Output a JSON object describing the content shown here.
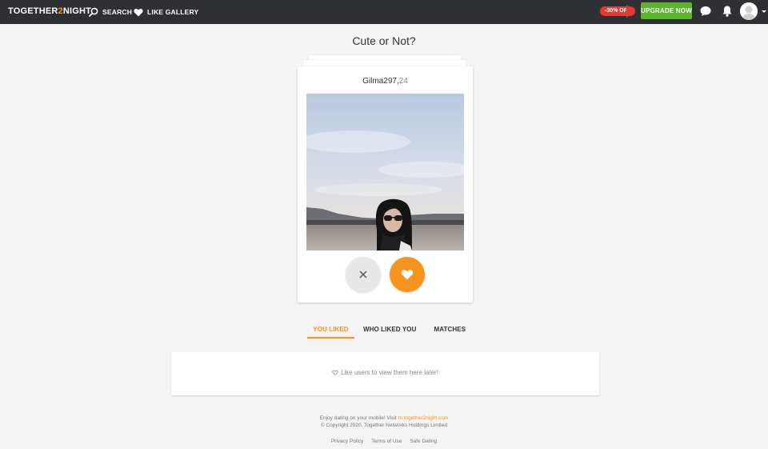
{
  "header": {
    "logo_prefix": "TOGETHER",
    "logo_accent": "2",
    "logo_suffix": "NIGHT",
    "nav": {
      "search_label": "SEARCH",
      "gallery_label": "LIKE GALLERY"
    },
    "offer_badge": "-30% OFF",
    "upgrade_label": "UPGRADE NOW",
    "icons": [
      "search-icon",
      "heart-icon",
      "chat-icon",
      "bell-icon",
      "avatar",
      "caret-down-icon"
    ]
  },
  "page": {
    "title": "Cute or Not?"
  },
  "card": {
    "username": "Gilma297,",
    "age": "24"
  },
  "tabs": {
    "you_liked": "YOU LIKED",
    "who_liked_you": "WHO LIKED YOU",
    "matches": "MATCHES",
    "active": "you_liked"
  },
  "panel": {
    "message": "Like users to view them here later!"
  },
  "footer": {
    "mobile_prefix": "Enjoy dating on your mobile! Visit ",
    "mobile_link": "m.together2night.com",
    "copyright": "© Copyright 2020, Together Networks Holdings Limited",
    "links": {
      "privacy": "Privacy Policy",
      "terms": "Terms of Use",
      "safe": "Safe Dating"
    }
  },
  "colors": {
    "topbar": "#2f3033",
    "accent": "#f7941d",
    "upgrade": "#5bb52f",
    "offer": "#e53935",
    "background": "#f4f4f4"
  }
}
